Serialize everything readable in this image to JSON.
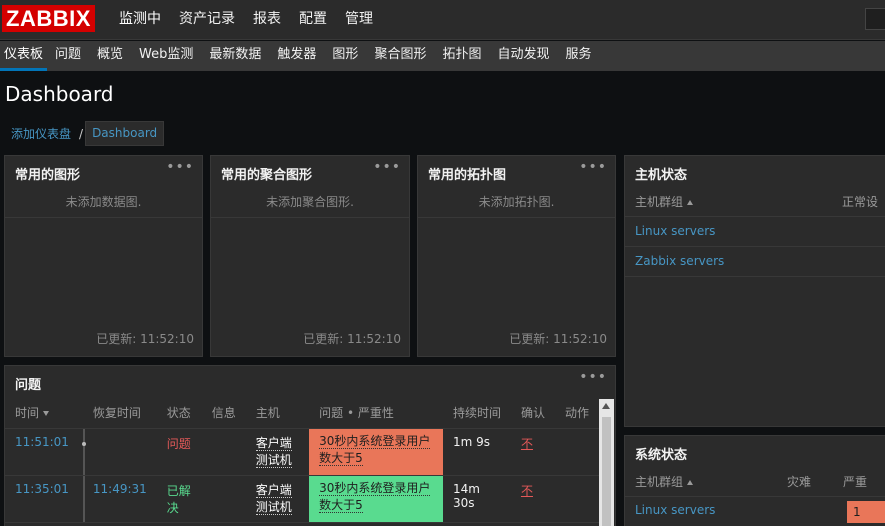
{
  "app": {
    "logo": "ZABBIX"
  },
  "topnav": {
    "items": [
      {
        "label": "监测中",
        "active": true
      },
      {
        "label": "资产记录"
      },
      {
        "label": "报表"
      },
      {
        "label": "配置"
      },
      {
        "label": "管理"
      }
    ]
  },
  "subnav": {
    "items": [
      {
        "label": "仪表板",
        "active": true
      },
      {
        "label": "问题"
      },
      {
        "label": "概览"
      },
      {
        "label": "Web监测"
      },
      {
        "label": "最新数据"
      },
      {
        "label": "触发器"
      },
      {
        "label": "图形"
      },
      {
        "label": "聚合图形"
      },
      {
        "label": "拓扑图"
      },
      {
        "label": "自动发现"
      },
      {
        "label": "服务"
      }
    ]
  },
  "page": {
    "title": "Dashboard"
  },
  "breadcrumb": {
    "parent": "添加仪表盘",
    "separator": "/",
    "current": "Dashboard"
  },
  "widgets": {
    "graphs": {
      "title": "常用的图形",
      "menu": "•••",
      "empty": "未添加数据图.",
      "updated": "已更新: 11:52:10"
    },
    "screens": {
      "title": "常用的聚合图形",
      "menu": "•••",
      "empty": "未添加聚合图形.",
      "updated": "已更新: 11:52:10"
    },
    "maps": {
      "title": "常用的拓扑图",
      "menu": "•••",
      "empty": "未添加拓扑图.",
      "updated": "已更新: 11:52:10"
    },
    "host_status": {
      "title": "主机状态",
      "col_group": "主机群组",
      "col_ok": "正常设",
      "rows": [
        "Linux servers",
        "Zabbix servers"
      ]
    },
    "system_status": {
      "title": "系统状态",
      "col_group": "主机群组",
      "col_disaster": "灾难",
      "col_severity": "严重",
      "rows": [
        {
          "group": "Linux servers",
          "severe": "1"
        }
      ]
    },
    "problems": {
      "title": "问题",
      "menu": "•••",
      "columns": [
        "时间",
        "恢复时间",
        "状态",
        "信息",
        "主机",
        "问题 • 严重性",
        "持续时间",
        "确认",
        "动作"
      ],
      "rows": [
        {
          "time": "11:51:01",
          "recovery": "",
          "status": "问题",
          "host": "客户端测试机",
          "problem": "30秒内系统登录用户数大于5",
          "duration": "1m 9s",
          "ack": "不"
        },
        {
          "time": "11:35:01",
          "recovery": "11:49:31",
          "status": "已解决",
          "host": "客户端测试机",
          "problem": "30秒内系统登录用户数大于5",
          "duration": "14m 30s",
          "ack": "不"
        }
      ]
    }
  }
}
